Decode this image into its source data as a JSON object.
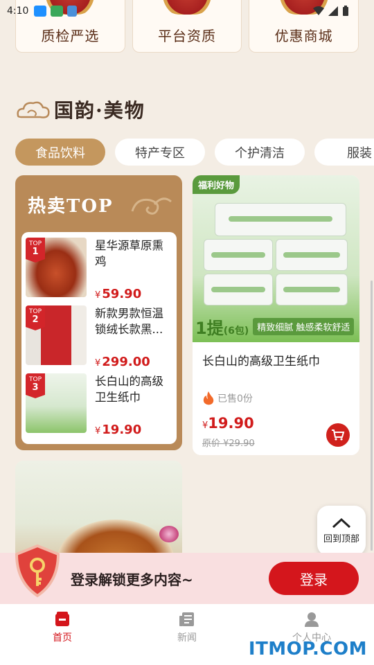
{
  "status_bar": {
    "time": "4:10"
  },
  "features": [
    {
      "label": "质检严选"
    },
    {
      "label": "平台资质"
    },
    {
      "label": "优惠商城"
    }
  ],
  "section": {
    "title": "国韵·美物"
  },
  "tabs": [
    {
      "label": "食品饮料",
      "active": true
    },
    {
      "label": "特产专区"
    },
    {
      "label": "个护清洁"
    },
    {
      "label": "服装"
    }
  ],
  "hot": {
    "title": "热卖TOP",
    "items": [
      {
        "rank_label": "TOP",
        "rank": "1",
        "name": "星华源草原熏鸡",
        "currency": "¥",
        "price": "59.90"
      },
      {
        "rank_label": "TOP",
        "rank": "2",
        "name": "新款男款恒温锁绒长款黑...",
        "currency": "¥",
        "price": "299.00"
      },
      {
        "rank_label": "TOP",
        "rank": "3",
        "name": "长白山的高级卫生纸巾",
        "currency": "¥",
        "price": "19.90"
      }
    ]
  },
  "product": {
    "tag": "福利好物",
    "banner_main": "1提",
    "banner_pack": "(6包)",
    "banner_sub": "精致细腻 触感柔软舒适",
    "name": "长白山的高级卫生纸巾",
    "sold": "已售0份",
    "currency": "¥",
    "price": "19.90",
    "original_price": "原价 ¥29.90"
  },
  "back_to_top": {
    "label": "回到顶部"
  },
  "login": {
    "prompt": "登录解锁更多内容~",
    "button": "登录"
  },
  "nav": [
    {
      "label": "首页",
      "active": true
    },
    {
      "label": "新闻"
    },
    {
      "label": "个人中心"
    }
  ],
  "watermark": "ITMOP.COM",
  "colors": {
    "accent_red": "#d4161c",
    "gold": "#c4975e",
    "background": "#f4ede4"
  }
}
